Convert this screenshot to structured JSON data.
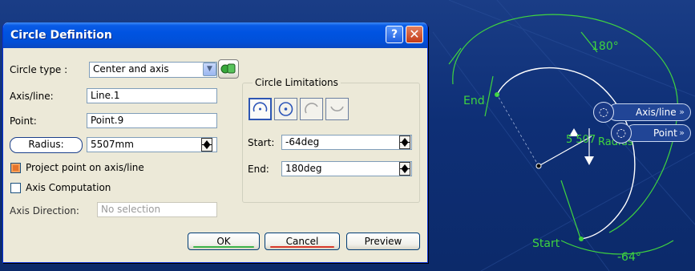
{
  "dialog": {
    "title": "Circle Definition",
    "help_icon": "question-mark-icon",
    "close_icon": "close-icon",
    "circle_type_label": "Circle type :",
    "circle_type_value": "Center and axis",
    "axis_line_label": "Axis/line:",
    "axis_line_value": "Line.1",
    "point_label": "Point:",
    "point_value": "Point.9",
    "radius_label": "Radius:",
    "radius_value": "5507mm",
    "project_point_label": "Project point on axis/line",
    "project_point_checked": true,
    "axis_computation_label": "Axis Computation",
    "axis_computation_checked": false,
    "axis_direction_label": "Axis Direction:",
    "axis_direction_placeholder": "No selection",
    "limits": {
      "title": "Circle Limitations",
      "modes": [
        "part-arc-icon",
        "whole-circle-icon",
        "trim-arc-icon",
        "complementary-arc-icon"
      ],
      "active_mode": 0,
      "start_label": "Start:",
      "start_value": "-64deg",
      "end_label": "End:",
      "end_value": "180deg"
    },
    "buttons": {
      "ok": "OK",
      "cancel": "Cancel",
      "preview": "Preview"
    }
  },
  "viewport": {
    "angle_top": "180°",
    "angle_bottom": "-64°",
    "end_label": "End",
    "start_label": "Start",
    "radius_label": "Radius",
    "radius_value_partial": "5 507",
    "axis_line_tag": "Axis/line",
    "point_tag": "Point",
    "tag_arrow": "»",
    "colors": {
      "geometry": "#3fd43f",
      "arc": "#ffffff",
      "background": "#102f74"
    }
  }
}
